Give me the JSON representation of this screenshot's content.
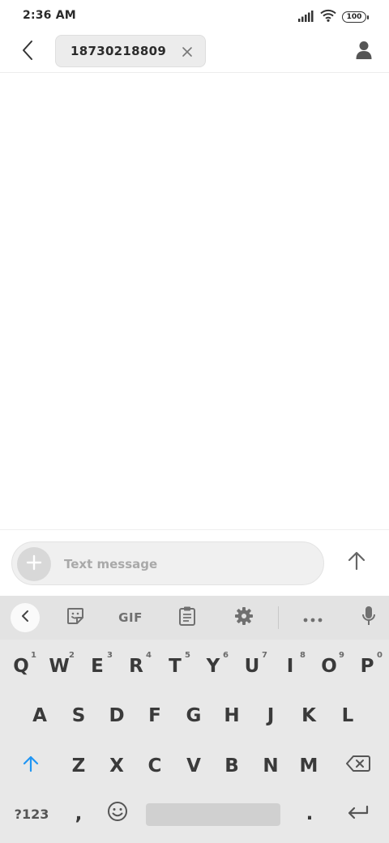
{
  "status_bar": {
    "time": "2:36 AM",
    "battery": "100",
    "icons": [
      "signal-icon",
      "wifi-icon",
      "battery-icon"
    ]
  },
  "header": {
    "back_icon": "back-arrow-icon",
    "recipient": "18730218809",
    "chip_close_icon": "close-icon",
    "contact_icon": "person-icon"
  },
  "composer": {
    "attach_icon": "plus-icon",
    "placeholder": "Text message",
    "value": "",
    "send_icon": "arrow-up-icon"
  },
  "keyboard": {
    "toolbar": {
      "items": [
        "chevron-left-icon",
        "sticker-icon",
        "GIF",
        "clipboard-icon",
        "gear-icon",
        "more-icon",
        "mic-icon"
      ],
      "gif_label": "GIF"
    },
    "row1": [
      {
        "key": "Q",
        "hint": "1"
      },
      {
        "key": "W",
        "hint": "2"
      },
      {
        "key": "E",
        "hint": "3"
      },
      {
        "key": "R",
        "hint": "4"
      },
      {
        "key": "T",
        "hint": "5"
      },
      {
        "key": "Y",
        "hint": "6"
      },
      {
        "key": "U",
        "hint": "7"
      },
      {
        "key": "I",
        "hint": "8"
      },
      {
        "key": "O",
        "hint": "9"
      },
      {
        "key": "P",
        "hint": "0"
      }
    ],
    "row2": [
      "A",
      "S",
      "D",
      "F",
      "G",
      "H",
      "J",
      "K",
      "L"
    ],
    "row3": [
      "Z",
      "X",
      "C",
      "V",
      "B",
      "N",
      "M"
    ],
    "row4": {
      "symbols_label": "?123",
      "comma": ",",
      "emoji_icon": "emoji-icon",
      "period": ".",
      "enter_icon": "enter-icon"
    },
    "shift_icon": "shift-arrow-icon",
    "backspace_icon": "backspace-icon",
    "accent_color": "#2196f3"
  }
}
